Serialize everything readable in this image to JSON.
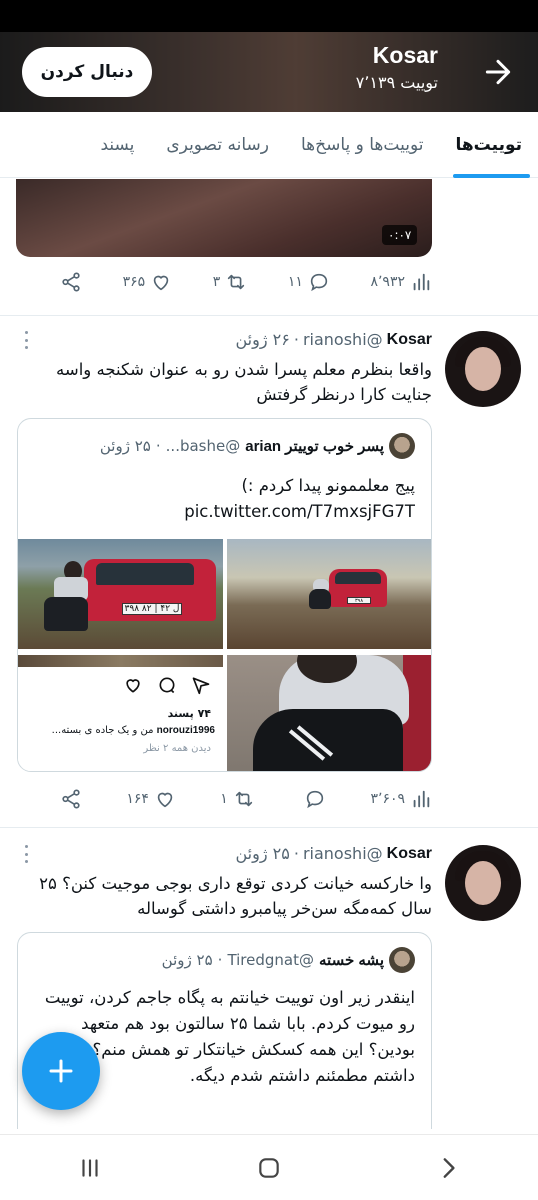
{
  "header": {
    "name": "Kosar",
    "tweet_count": "۷٬۱۳۹ توییت",
    "follow_label": "دنبال کردن"
  },
  "tabs": [
    {
      "label": "توییت‌ها",
      "active": true
    },
    {
      "label": "توییت‌ها و پاسخ‌ها",
      "active": false
    },
    {
      "label": "رسانه تصویری",
      "active": false
    },
    {
      "label": "پسند",
      "active": false
    }
  ],
  "tweets": [
    {
      "video_duration": "۰:۰۷",
      "stats": {
        "views": "۸٬۹۳۲",
        "replies": "۱۱",
        "retweets": "۳",
        "likes": "۳۶۵"
      }
    },
    {
      "name": "Kosar",
      "handle": "@rianoshi",
      "date": "۲۶ ژوئن",
      "text": "واقعا بنظرم معلم پسرا شدن رو به عنوان شکنجه واسه جنایت کارا درنظر گرفتش",
      "quote": {
        "display_name": "پسر خوب توییتر arian",
        "handle": "@bashe...",
        "date": "۲۵ ژوئن",
        "text": "پیج معلممونو پیدا کردم :) pic.twitter.com/T7mxsjFG7T",
        "plate_1": "۳۹۸ ل ۴۲ | ۸۲",
        "plate_2": "۳۹۸",
        "insta_likes": "۷۴ پسند",
        "insta_user": "norouzi1996",
        "insta_caption": "من و یک جاده ی بسته...",
        "insta_view": "دیدن همه ۲ نظر"
      },
      "stats": {
        "views": "۳٬۶۰۹",
        "replies": "",
        "retweets": "۱",
        "likes": "۱۶۴"
      }
    },
    {
      "name": "Kosar",
      "handle": "@rianoshi",
      "date": "۲۵ ژوئن",
      "text": "وا خارکسه خیانت کردی توقع داری بوجی موجیت کنن؟ ۲۵ سال کمه‌مگه سن‌خر پیامبرو داشتی گوساله",
      "quote": {
        "display_name": "پشه خسته",
        "handle": "@Tiredgnat",
        "date": "۲۵ ژوئن",
        "text": "اینقدر زیر اون توییت خیانتم به پگاه جاجم کردن، توییت رو میوت کردم. بابا شما ۲۵ سالتون بود هم متعهد بودین؟ این همه کسکش خیانتکار تو همش منم؟ دوستش داشتم مطمئنم داشتم شدم دیگه."
      }
    }
  ],
  "colors": {
    "accent": "#1d9bf0",
    "text": "#0f1419",
    "muted": "#536471"
  }
}
